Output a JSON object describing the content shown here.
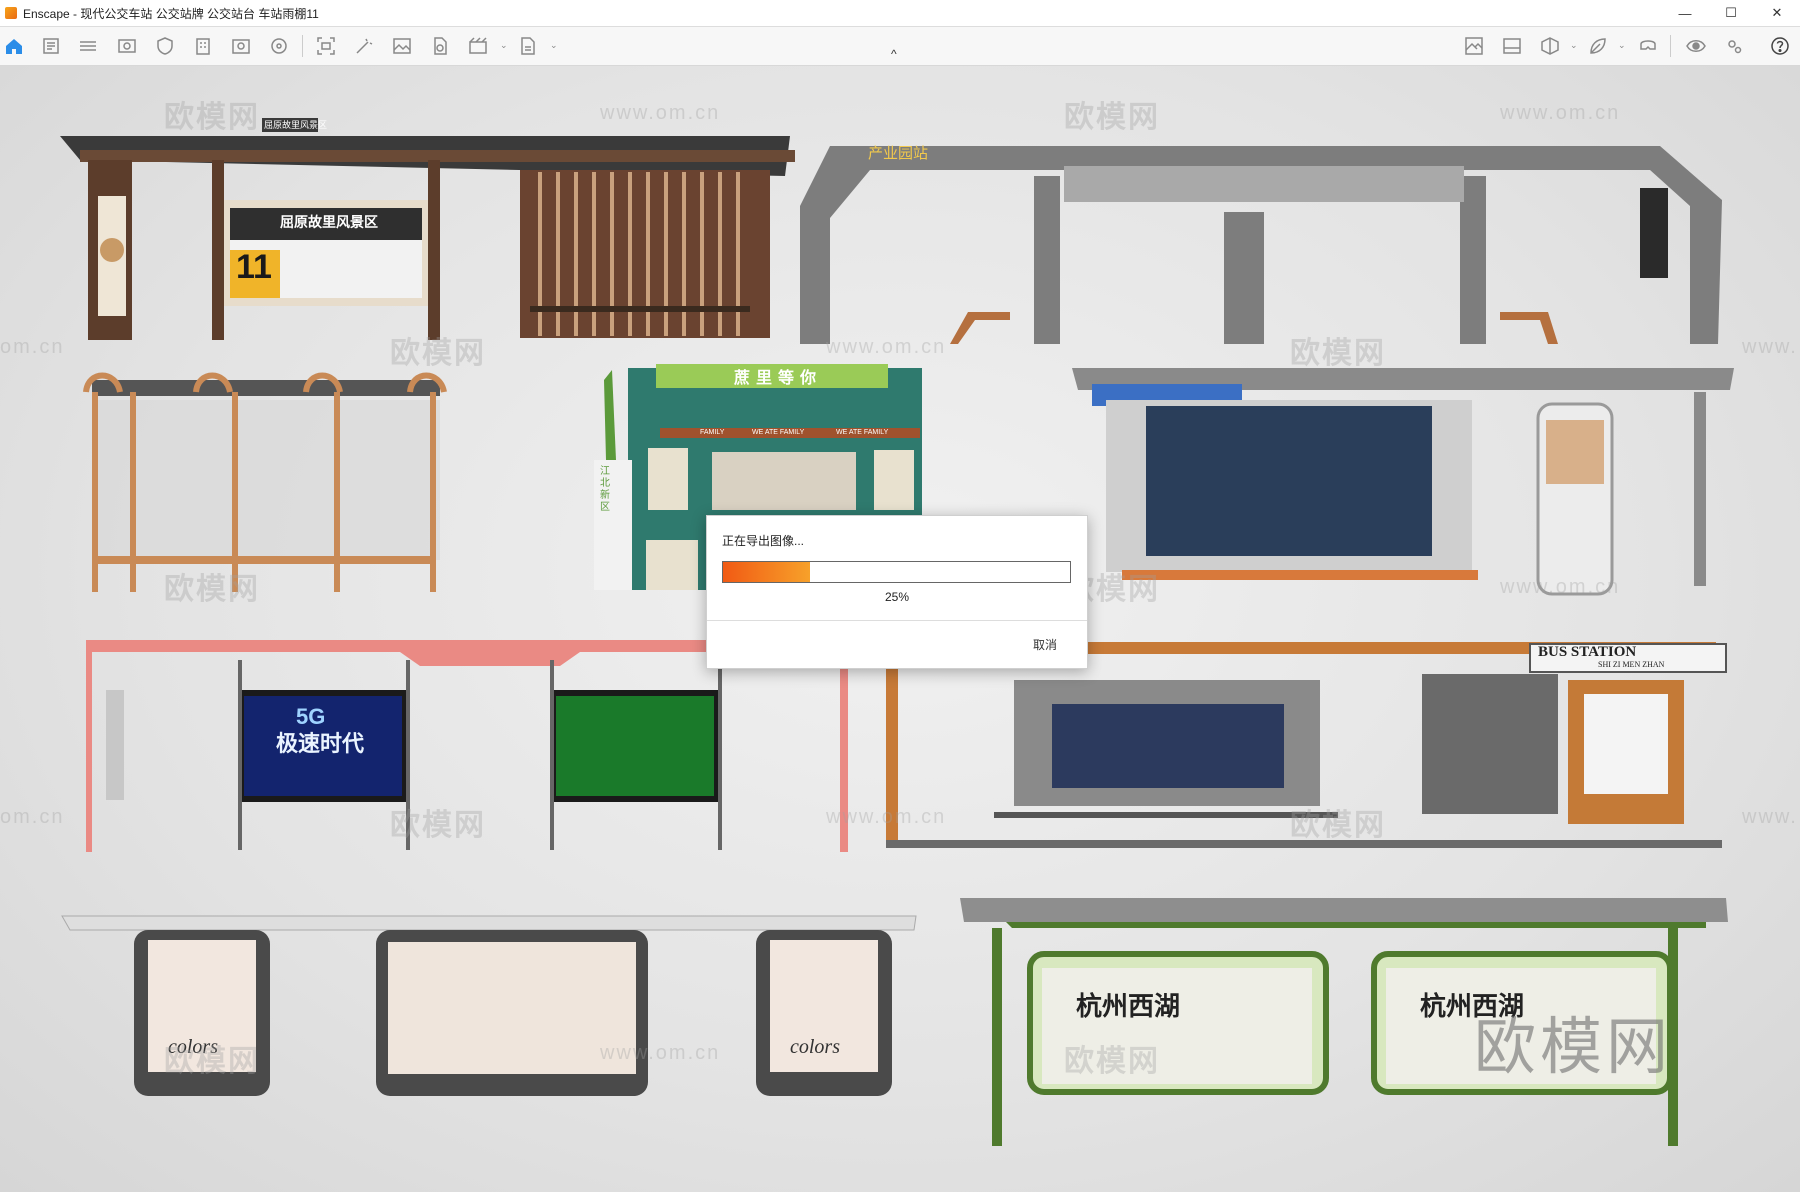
{
  "window": {
    "app_name": "Enscape",
    "title": "Enscape - 现代公交车站 公交站牌 公交站台 车站雨棚11",
    "controls": [
      "minimize-icon",
      "maximize-icon",
      "close-icon"
    ]
  },
  "toolbar": {
    "left_icons": [
      "home-icon",
      "doc-icon",
      "bim-icon",
      "view-icon",
      "shield-icon",
      "building-icon",
      "library-icon",
      "assets-icon",
      "capture-icon",
      "magic-icon",
      "image-icon",
      "export-icon",
      "video-icon",
      "batch-icon"
    ],
    "right_icons": [
      "material-icon",
      "landscape-icon",
      "cube-icon",
      "leaf-icon",
      "vr-icon",
      "visibility-icon",
      "settings-icon",
      "help-icon"
    ],
    "collapse_glyph": "^"
  },
  "viewport": {
    "watermarks": [
      "欧模网",
      "www.om.cn",
      "om.cn",
      "www."
    ],
    "signs": {
      "shelter1_top": "屈原故里风景区",
      "shelter1_route": "11",
      "shelter1_name": "屈原故里风景区",
      "shelter2_name": "产业园站",
      "kiosk_name": "蔗里等你",
      "kiosk_strip": [
        "FAMILY",
        "WE ATE FAMILY",
        "WE ATE FAMILY"
      ],
      "kiosk_side": "江北新区",
      "poster_5g_top": "5G",
      "poster_5g_main": "极速时代",
      "bus_station": "BUS STATION",
      "bus_station_sub": "SHI ZI MEN ZHAN",
      "poster_colors": "colors",
      "poster_westlake": "杭州西湖",
      "watermark_big": "欧模网"
    }
  },
  "dialog": {
    "title": "正在导出图像...",
    "progress": 0.25,
    "percent_label": "25%",
    "cancel_label": "取消"
  }
}
